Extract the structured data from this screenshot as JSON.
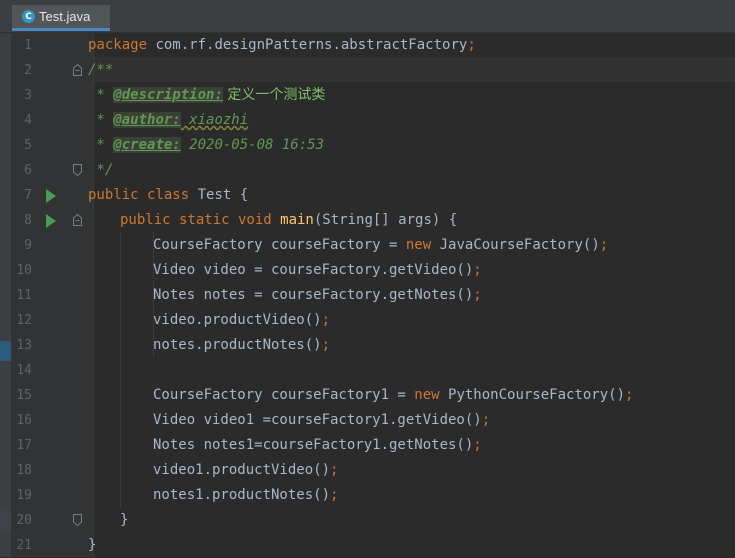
{
  "tab": {
    "label": "Test.java",
    "icon": "java-class-icon",
    "icon_glyph": "C"
  },
  "colors": {
    "keyword": "#cc7832",
    "method": "#ffc66d",
    "doc_comment": "#629755",
    "plain": "#a9b7c6",
    "line_number": "#606366",
    "run_gutter": "#499c54"
  },
  "lines": [
    {
      "num": "1",
      "pkg_kw": "package",
      "pkg_name": " com.rf.designPatterns.abstractFactory",
      "semi": ";"
    },
    {
      "num": "2",
      "text": "/**"
    },
    {
      "num": "3",
      "star": " * ",
      "tag": "@description:",
      "value": " 定义一个测试类"
    },
    {
      "num": "4",
      "star": " * ",
      "tag": "@author:",
      "value": " xiaozhi"
    },
    {
      "num": "5",
      "star": " * ",
      "tag": "@create:",
      "value": " 2020-05-08 16:53"
    },
    {
      "num": "6",
      "text": " */"
    },
    {
      "num": "7",
      "kw": "public class",
      "rest": " Test {"
    },
    {
      "num": "8",
      "kw": "public static void",
      "method": " main",
      "rest": "(String[] args) {"
    },
    {
      "num": "9",
      "a": "CourseFactory courseFactory = ",
      "kw": "new",
      "b": " JavaCourseFactory()",
      "semi": ";"
    },
    {
      "num": "10",
      "a": "Video video = courseFactory.getVideo()",
      "semi": ";"
    },
    {
      "num": "11",
      "a": "Notes notes = courseFactory.getNotes()",
      "semi": ";"
    },
    {
      "num": "12",
      "a": "video.productVideo()",
      "semi": ";"
    },
    {
      "num": "13",
      "a": "notes.productNotes()",
      "semi": ";"
    },
    {
      "num": "14"
    },
    {
      "num": "15",
      "a": "CourseFactory courseFactory1 = ",
      "kw": "new",
      "b": " PythonCourseFactory()",
      "semi": ";"
    },
    {
      "num": "16",
      "a": "Video video1 =courseFactory1.getVideo()",
      "semi": ";"
    },
    {
      "num": "17",
      "a": "Notes notes1=courseFactory1.getNotes()",
      "semi": ";"
    },
    {
      "num": "18",
      "a": "video1.productVideo()",
      "semi": ";"
    },
    {
      "num": "19",
      "a": "notes1.productNotes()",
      "semi": ";"
    },
    {
      "num": "20",
      "text": "}"
    },
    {
      "num": "21",
      "text": "}"
    }
  ]
}
